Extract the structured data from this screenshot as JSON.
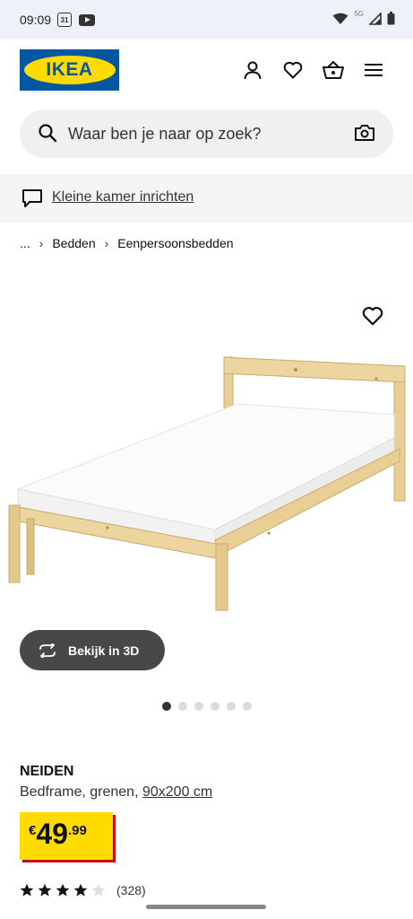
{
  "status_bar": {
    "time": "09:09",
    "calendar_day": "31",
    "network": "5G"
  },
  "header": {
    "logo_text": "IKEA",
    "brand_blue": "#0058a3",
    "brand_yellow": "#ffdb00"
  },
  "search": {
    "placeholder": "Waar ben je naar op zoek?"
  },
  "promo": {
    "link_text": "Kleine kamer inrichten"
  },
  "breadcrumb": {
    "items": [
      "...",
      "Bedden",
      "Eenpersoonsbedden"
    ]
  },
  "gallery": {
    "view_3d_label": "Bekijk in 3D",
    "image_count": 6,
    "active_index": 0
  },
  "product": {
    "name": "NEIDEN",
    "description": "Bedframe, grenen, ",
    "size": "90x200 cm",
    "price": {
      "currency": "€",
      "integer": "49",
      "decimal": ".99"
    },
    "rating": {
      "stars": 4,
      "max": 5,
      "count": "(328)"
    }
  }
}
